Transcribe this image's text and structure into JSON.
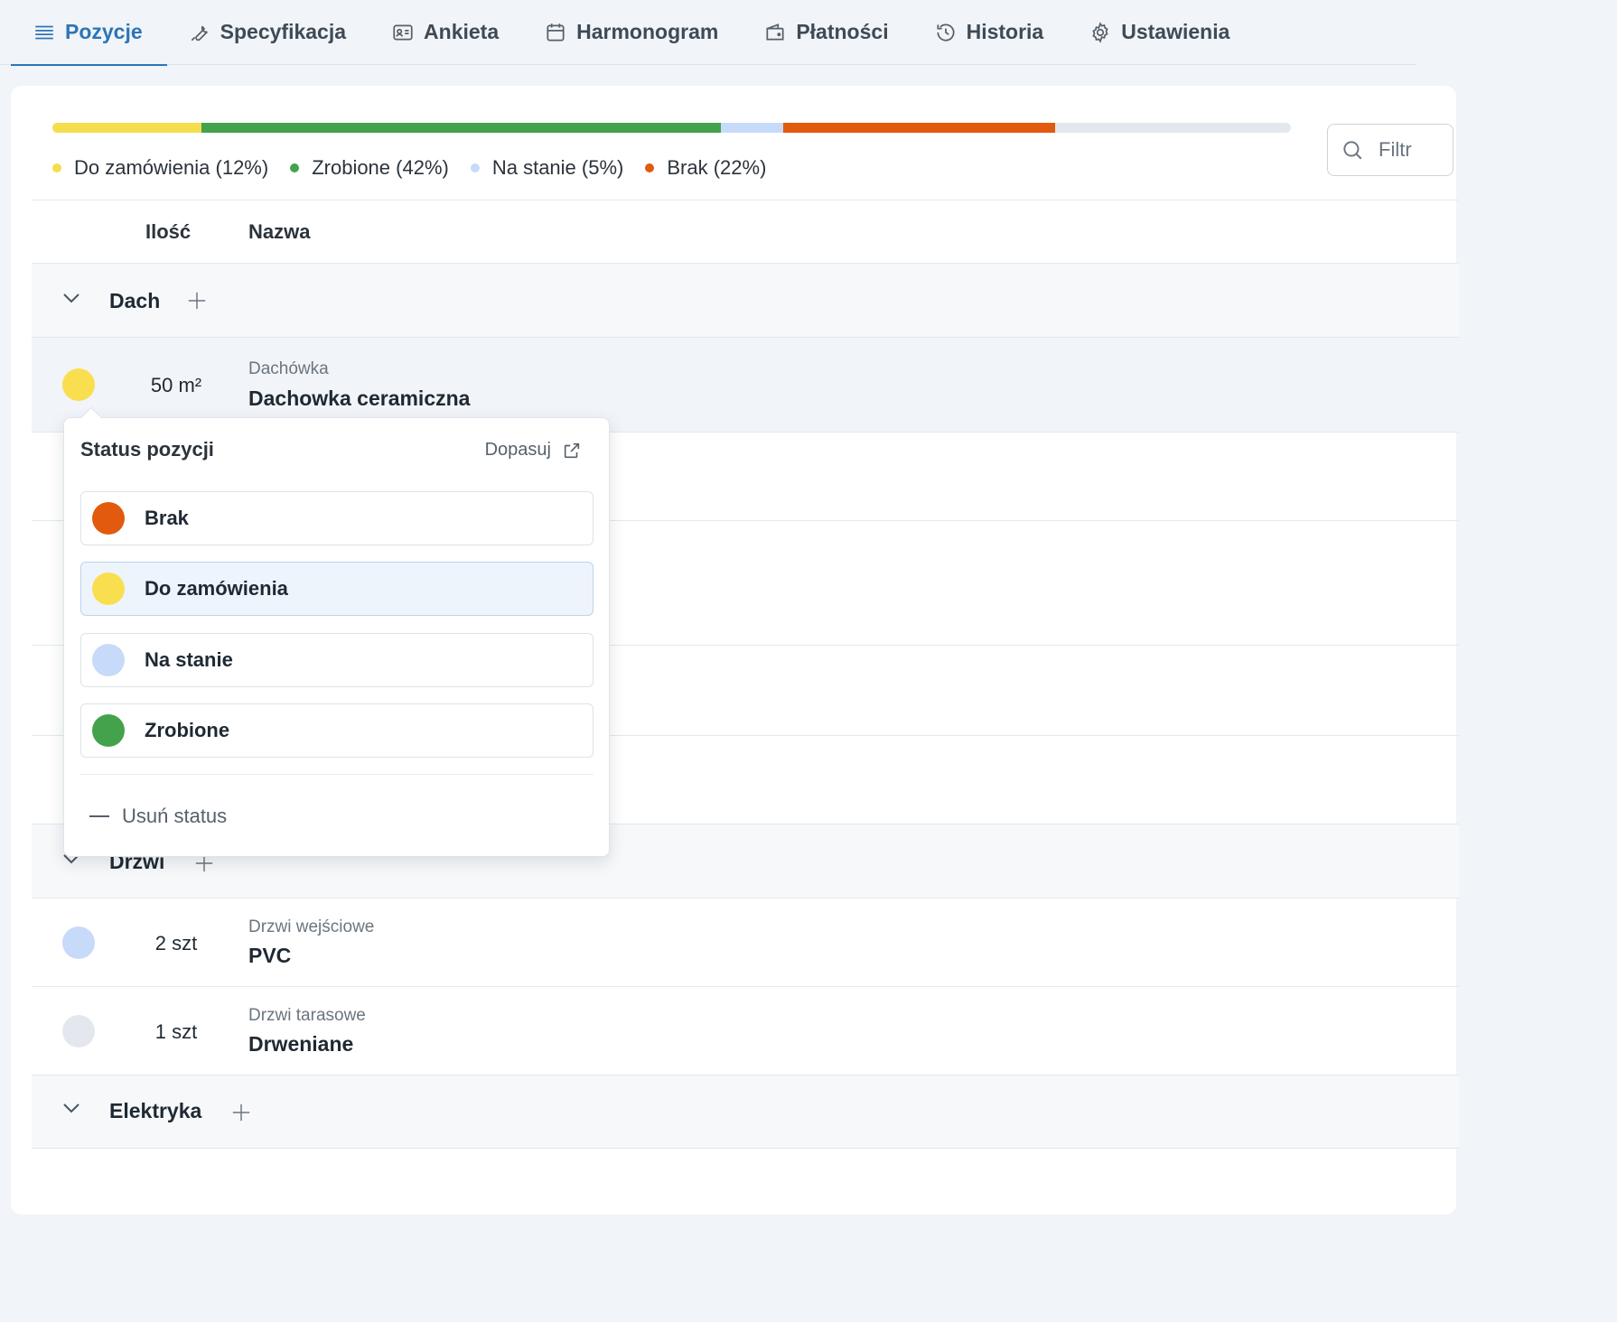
{
  "tabs": [
    {
      "label": "Pozycje",
      "icon": "list-icon",
      "active": true
    },
    {
      "label": "Specyfikacja",
      "icon": "wrench-icon",
      "active": false
    },
    {
      "label": "Ankieta",
      "icon": "id-card-icon",
      "active": false
    },
    {
      "label": "Harmonogram",
      "icon": "calendar-icon",
      "active": false
    },
    {
      "label": "Płatności",
      "icon": "wallet-icon",
      "active": false
    },
    {
      "label": "Historia",
      "icon": "history-icon",
      "active": false
    },
    {
      "label": "Ustawienia",
      "icon": "gear-icon",
      "active": false
    }
  ],
  "progress": {
    "segments": [
      {
        "label": "Do zamówienia (12%)",
        "percent": 12,
        "color": "#f5dd4d"
      },
      {
        "label": "Zrobione (42%)",
        "percent": 42,
        "color": "#43a24b"
      },
      {
        "label": "Na stanie (5%)",
        "percent": 5,
        "color": "#c7dafa"
      },
      {
        "label": "Brak (22%)",
        "percent": 22,
        "color": "#e25a0d"
      }
    ],
    "track_color": "#e3e8ee"
  },
  "filter": {
    "placeholder": "Filtr"
  },
  "table": {
    "columns": {
      "qty": "Ilość",
      "name": "Nazwa"
    },
    "groups": [
      {
        "name": "Dach",
        "items": [
          {
            "status_color": "#f9df4f",
            "qty": "50 m²",
            "category": "Dachówka",
            "name": "Dachowka ceramiczna"
          }
        ]
      },
      {
        "name": "Drzwi",
        "items": [
          {
            "status_color": "#c7dafa",
            "qty": "2 szt",
            "category": "Drzwi wejściowe",
            "name": "PVC"
          },
          {
            "status_color": "#e4e8ee",
            "qty": "1 szt",
            "category": "Drzwi tarasowe",
            "name": "Drweniane"
          }
        ]
      },
      {
        "name": "Elektryka",
        "items": []
      }
    ]
  },
  "popover": {
    "title": "Status pozycji",
    "adjust_label": "Dopasuj",
    "options": [
      {
        "label": "Brak",
        "color": "#e25a0d",
        "selected": false
      },
      {
        "label": "Do zamówienia",
        "color": "#f9df4f",
        "selected": true
      },
      {
        "label": "Na stanie",
        "color": "#c7dafa",
        "selected": false
      },
      {
        "label": "Zrobione",
        "color": "#43a24b",
        "selected": false
      }
    ],
    "remove_label": "Usuń status"
  }
}
